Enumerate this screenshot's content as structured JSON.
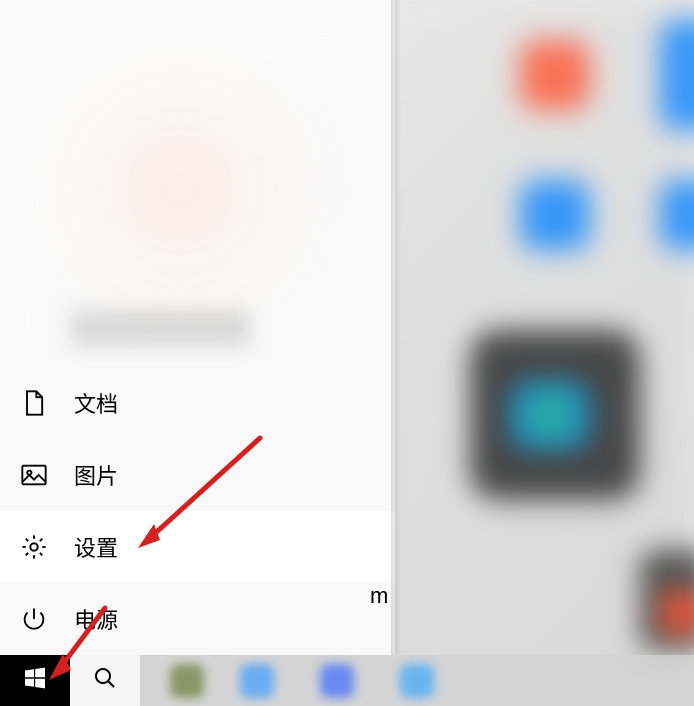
{
  "menu": {
    "documents": {
      "label": "文档"
    },
    "pictures": {
      "label": "图片"
    },
    "settings": {
      "label": "设置"
    },
    "power": {
      "label": "电源"
    }
  },
  "stray_char": "m",
  "annotations": {
    "arrow1_target": "settings-menu-item",
    "arrow2_target": "start-button"
  }
}
